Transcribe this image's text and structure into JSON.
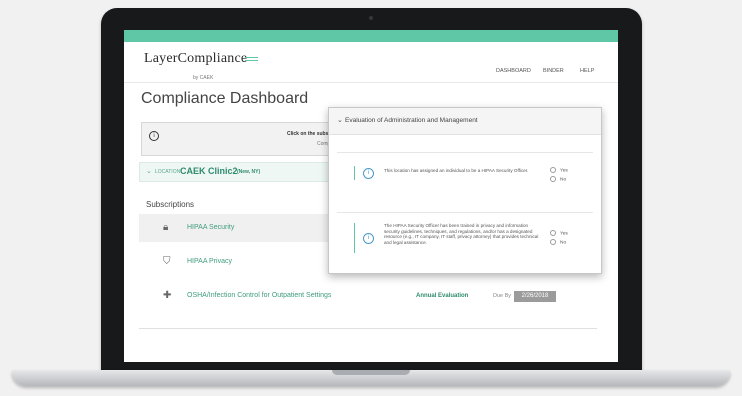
{
  "header": {
    "logo": "LayerCompliance",
    "logo_sub": "by CAEK",
    "nav": [
      "DASHBOARD",
      "BINDER",
      "HELP"
    ]
  },
  "page_title": "Compliance Dashboard",
  "notice": {
    "line1": "Click on the subscrip",
    "line2": "Complianc"
  },
  "location": {
    "label": "LOCATION",
    "name": "CAEK Clinic2",
    "tag": "(New, NY)"
  },
  "subscriptions": {
    "title": "Subscriptions",
    "items": [
      {
        "name": "HIPAA Security",
        "icon": "lock-icon"
      },
      {
        "name": "HIPAA Privacy",
        "icon": "shield-icon"
      },
      {
        "name": "OSHA/Infection Control for Outpatient Settings",
        "icon": "medical-kit-icon",
        "status": "Annual Evaluation",
        "due_label": "Due By",
        "due_date": "2/26/2018"
      }
    ]
  },
  "modal": {
    "title": "Evaluation of Administration and Management",
    "questions": [
      {
        "text": "This location has assigned an individual to be a HIPAA Security Officer.",
        "options": [
          "Yes",
          "No"
        ]
      },
      {
        "text": "The HIPAA Security Officer has been trained in privacy and information security guidelines, techniques, and regulations, and/or has a designated resource (e.g., IT company, IT staff, privacy attorney) that provides technical and legal assistance.",
        "options": [
          "Yes",
          "No"
        ]
      }
    ]
  },
  "colors": {
    "accent": "#5fc7a6",
    "link": "#3f9c7f",
    "info": "#4a9acb"
  }
}
